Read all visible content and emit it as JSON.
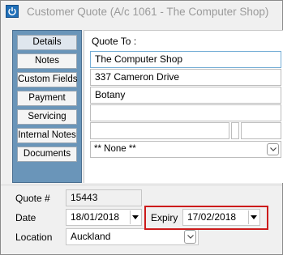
{
  "window": {
    "title": "Customer Quote (A/c 1061 - The Computer Shop)"
  },
  "sidebar": {
    "items": [
      {
        "label": "Details"
      },
      {
        "label": "Notes"
      },
      {
        "label": "Custom Fields"
      },
      {
        "label": "Payment"
      },
      {
        "label": "Servicing"
      },
      {
        "label": "Internal Notes"
      },
      {
        "label": "Documents"
      }
    ]
  },
  "quote_to": {
    "label": "Quote To :",
    "lines": [
      "The Computer Shop",
      "337 Cameron Drive",
      "Botany",
      ""
    ],
    "selection": "** None **"
  },
  "form": {
    "quote_no_label": "Quote #",
    "quote_no": "15443",
    "date_label": "Date",
    "date": "18/01/2018",
    "expiry_label": "Expiry",
    "expiry": "17/02/2018",
    "location_label": "Location",
    "location": "Auckland"
  },
  "colors": {
    "highlight": "#cc1b1b",
    "sidebar": "#6a95b9"
  }
}
